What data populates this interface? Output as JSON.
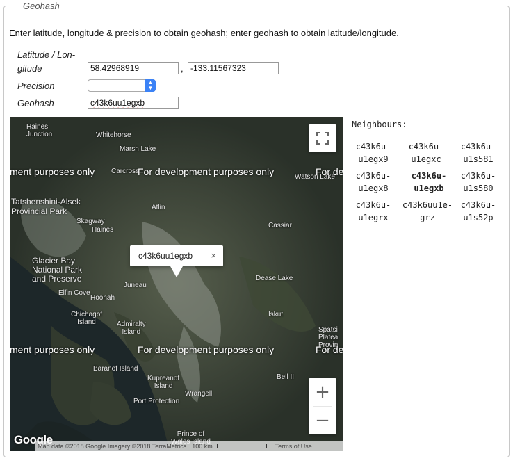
{
  "legend": "Geohash",
  "intro": "Enter latitude, longitude & precision to obtain geohash; enter geohash to obtain latitude/longitude.",
  "form": {
    "latlon_label_line1": "Latitude / Lon-",
    "latlon_label_line2": "gitude",
    "latitude": "58.42968919",
    "comma": ",",
    "longitude": "-133.11567323",
    "precision_label": "Precision",
    "precision_value": "",
    "geohash_label": "Geohash",
    "geohash": "c43k6uu1egxb"
  },
  "map": {
    "dev_watermark": "For development purposes only",
    "dev_watermark_cut_left": "ment purposes only",
    "dev_watermark_cut_right": "For dev",
    "infowindow_text": "c43k6uu1egxb",
    "close_glyph": "×",
    "zoom_in": "+",
    "zoom_out": "−",
    "google_logo": "Google",
    "attribution": "Map data ©2018 Google Imagery ©2018 TerraMetrics",
    "scale": "100 km",
    "terms": "Terms of Use",
    "place_labels": {
      "haines_junction": "Haines\nJunction",
      "whitehorse": "Whitehorse",
      "marsh_lake": "Marsh Lake",
      "carcross": "Carcross",
      "watson_lake": "Watson Lake",
      "tatshenshini": "Tatshenshini-Alsek\nProvincial Park",
      "atlin": "Atlin",
      "skagway": "Skagway",
      "haines": "Haines",
      "cassiar": "Cassiar",
      "glacier_bay": "Glacier Bay\nNational Park\nand Preserve",
      "juneau": "Juneau",
      "elfin_cove": "Elfin Cove",
      "hoonah": "Hoonah",
      "dease_lake": "Dease Lake",
      "chichagof": "Chichagof\nIsland",
      "admiralty": "Admiralty\nIsland",
      "iskut": "Iskut",
      "spatsizi": "Spatsi\nPlatea\nProvin",
      "baranof": "Baranof Island",
      "kupreanof": "Kupreanof\nIsland",
      "wrangell": "Wrangell",
      "port_protection": "Port Protection",
      "bell_ii": "Bell II",
      "prince_of_wales": "Prince of\nWales Island"
    }
  },
  "neighbours": {
    "title": "Neighbours:",
    "cells": [
      [
        "c43k6u-\nu1egx9",
        "c43k6u-\nu1egxc",
        "c43k6u-\nu1s581"
      ],
      [
        "c43k6u-\nu1egx8",
        "c43k6u-\nu1egxb",
        "c43k6u-\nu1s580"
      ],
      [
        "c43k6u-\nu1egrx",
        "c43k6uu1e-\ngrz",
        "c43k6u-\nu1s52p"
      ]
    ]
  },
  "colors": {
    "map_water": "#1b2424",
    "zoom_glyph": "#666666",
    "fieldset_border": "#c8c8c8"
  }
}
